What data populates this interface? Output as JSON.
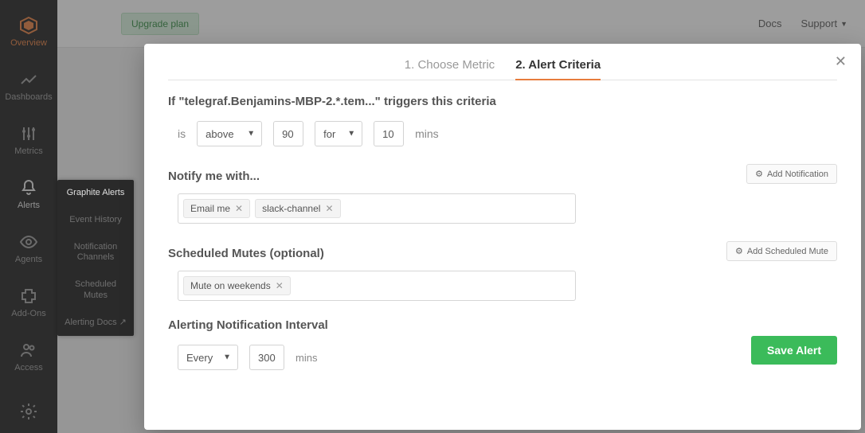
{
  "sidebar": {
    "items": [
      {
        "label": "Overview"
      },
      {
        "label": "Dashboards"
      },
      {
        "label": "Metrics"
      },
      {
        "label": "Alerts"
      },
      {
        "label": "Agents"
      },
      {
        "label": "Add-Ons"
      },
      {
        "label": "Access"
      }
    ]
  },
  "sub_sidebar": {
    "items": [
      {
        "label": "Graphite Alerts"
      },
      {
        "label": "Event History"
      },
      {
        "label": "Notification Channels"
      },
      {
        "label": "Scheduled Mutes"
      },
      {
        "label": "Alerting Docs ↗"
      }
    ]
  },
  "topbar": {
    "upgrade": "Upgrade plan",
    "docs": "Docs",
    "support": "Support"
  },
  "modal": {
    "tabs": {
      "choose_metric": "1. Choose Metric",
      "alert_criteria": "2. Alert Criteria"
    },
    "trigger_heading": "If \"telegraf.Benjamins-MBP-2.*.tem...\" triggers this criteria",
    "criteria": {
      "is_label": "is",
      "comparator": "above",
      "threshold": "90",
      "for_label": "for",
      "for_comparator": "",
      "duration": "10",
      "duration_unit": "mins"
    },
    "notify": {
      "heading": "Notify me with...",
      "add_btn": "Add Notification",
      "chips": [
        {
          "label": "Email me"
        },
        {
          "label": "slack-channel"
        }
      ]
    },
    "mutes": {
      "heading": "Scheduled Mutes (optional)",
      "add_btn": "Add Scheduled Mute",
      "chips": [
        {
          "label": "Mute on weekends"
        }
      ]
    },
    "interval": {
      "heading": "Alerting Notification Interval",
      "mode": "Every",
      "value": "300",
      "unit": "mins"
    },
    "save": "Save Alert"
  }
}
